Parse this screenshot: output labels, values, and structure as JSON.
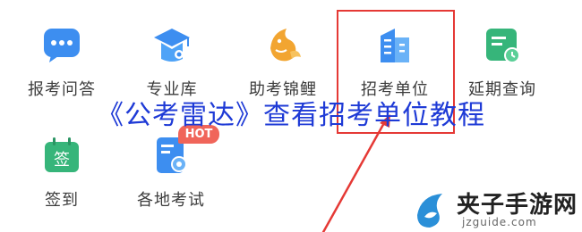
{
  "grid": {
    "items": [
      {
        "label": "报考问答",
        "icon": "chat-bubble-icon",
        "color": "#3d8ef0"
      },
      {
        "label": "专业库",
        "icon": "graduation-cap-icon",
        "color": "#3d8ef0"
      },
      {
        "label": "助考锦鲤",
        "icon": "koi-fish-icon",
        "color": "#f2a531"
      },
      {
        "label": "招考单位",
        "icon": "building-icon",
        "color": "#3d8ef0"
      },
      {
        "label": "延期查询",
        "icon": "calendar-clock-icon",
        "color": "#36b57a"
      },
      {
        "label": "签到",
        "icon": "checkin-calendar-icon",
        "color": "#36b57a"
      },
      {
        "label": "各地考试",
        "icon": "exam-document-icon",
        "color": "#3d8ef0"
      }
    ]
  },
  "badge": {
    "text": "HOT",
    "color": "#f0655a"
  },
  "highlight_color": "#e53935",
  "checkin_glyph": "签",
  "overlay": {
    "title": "《公考雷达》查看招考单位教程",
    "color": "#1e3ad6"
  },
  "watermark": {
    "name": "夹子手游网",
    "url": "jzguide.com"
  }
}
